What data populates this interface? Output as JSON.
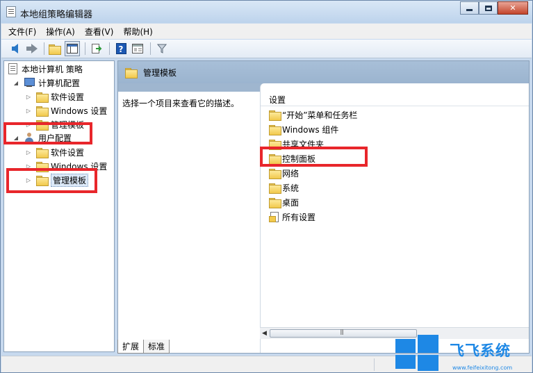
{
  "window": {
    "title": "本地组策略编辑器"
  },
  "title_buttons": {
    "close": "✕"
  },
  "menu": [
    "文件(F)",
    "操作(A)",
    "查看(V)",
    "帮助(H)"
  ],
  "toolbar": {
    "icons": [
      "back-arrow-icon",
      "forward-arrow-icon",
      "up-folder-icon",
      "show-hide-tree-icon",
      "export-list-icon",
      "help-icon",
      "properties-icon",
      "filter-icon"
    ],
    "help_glyph": "?"
  },
  "tree": {
    "root": "本地计算机 策略",
    "computer_config": "计算机配置",
    "computer_children": [
      "软件设置",
      "Windows 设置",
      "管理模板"
    ],
    "user_config": "用户配置",
    "user_children": [
      "软件设置",
      "Windows 设置",
      "管理模板"
    ]
  },
  "right_pane": {
    "header_title": "管理模板",
    "description": "选择一个项目来查看它的描述。",
    "column_header": "设置",
    "items": [
      "“开始”菜单和任务栏",
      "Windows 组件",
      "共享文件夹",
      "控制面板",
      "网络",
      "系统",
      "桌面",
      "所有设置"
    ]
  },
  "tabs": [
    "扩展",
    "标准"
  ],
  "watermark": {
    "brand": "飞飞系统",
    "url": "www.feifeixitong.com"
  },
  "colors": {
    "highlight": "#e8262b",
    "watermark": "#1e88e5",
    "header_band": "#9fb6cf"
  }
}
